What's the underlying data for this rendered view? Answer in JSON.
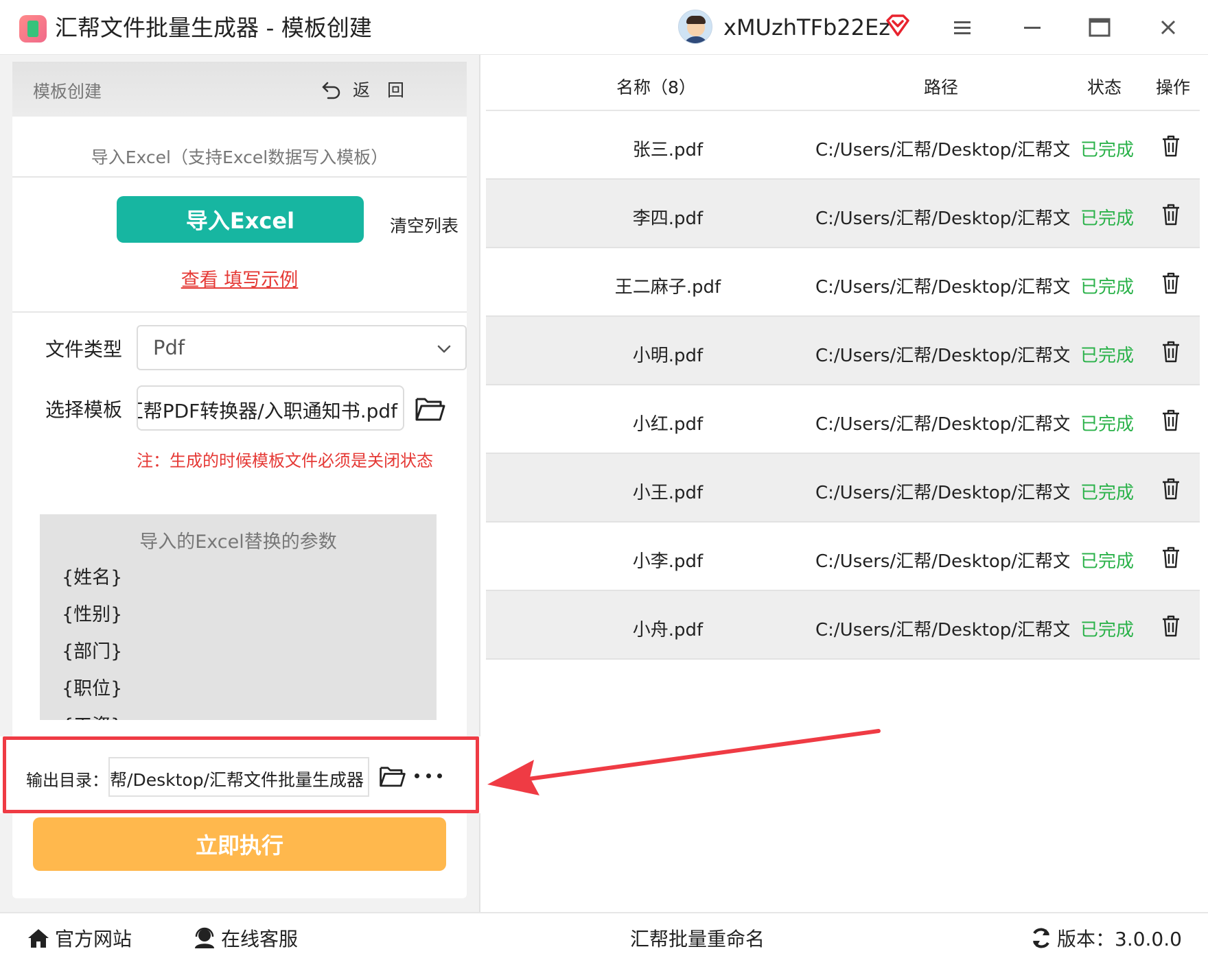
{
  "window": {
    "title": "汇帮文件批量生成器 - 模板创建",
    "username": "xMUzhTFb22Ez"
  },
  "panel": {
    "header_title": "模板创建",
    "back_label": "返　回",
    "import_subtitle": "导入Excel（支持Excel数据写入模板）",
    "import_button": "导入Excel",
    "clear_list": "清空列表",
    "view_example": "查看 填写示例",
    "file_type_label": "文件类型",
    "file_type_value": "Pdf",
    "template_label": "选择模板",
    "template_value": "汇帮PDF转换器/入职通知书.pdf",
    "warning": "注：生成的时候模板文件必须是关闭状态",
    "params_title": "导入的Excel替换的参数",
    "params": [
      "{姓名}",
      "{性别}",
      "{部门}",
      "{职位}",
      "{工资}"
    ],
    "output_label": "输出目录：",
    "output_value": "C:/Users/汇帮/Desktop/汇帮文件批量生成器",
    "run_button": "立即执行"
  },
  "table": {
    "headers": {
      "name": "名称（8）",
      "path": "路径",
      "status": "状态",
      "action": "操作"
    },
    "rows": [
      {
        "name": "张三.pdf",
        "path": "C:/Users/汇帮/Desktop/汇帮文件",
        "status": "已完成"
      },
      {
        "name": "李四.pdf",
        "path": "C:/Users/汇帮/Desktop/汇帮文件",
        "status": "已完成"
      },
      {
        "name": "王二麻子.pdf",
        "path": "C:/Users/汇帮/Desktop/汇帮文件",
        "status": "已完成"
      },
      {
        "name": "小明.pdf",
        "path": "C:/Users/汇帮/Desktop/汇帮文件",
        "status": "已完成"
      },
      {
        "name": "小红.pdf",
        "path": "C:/Users/汇帮/Desktop/汇帮文件",
        "status": "已完成"
      },
      {
        "name": "小王.pdf",
        "path": "C:/Users/汇帮/Desktop/汇帮文件",
        "status": "已完成"
      },
      {
        "name": "小李.pdf",
        "path": "C:/Users/汇帮/Desktop/汇帮文件",
        "status": "已完成"
      },
      {
        "name": "小舟.pdf",
        "path": "C:/Users/汇帮/Desktop/汇帮文件",
        "status": "已完成"
      }
    ]
  },
  "statusbar": {
    "official_site": "官方网站",
    "online_service": "在线客服",
    "center_text": "汇帮批量重命名",
    "version": "版本：3.0.0.0"
  },
  "icons": {
    "app": "app-logo-icon",
    "vip": "diamond-vip-icon",
    "menu": "hamburger-icon",
    "minimize": "minimize-icon",
    "maximize": "maximize-icon",
    "close": "close-icon",
    "back": "back-arrow-icon",
    "dropdown": "chevron-down-icon",
    "folder": "folder-open-icon",
    "more": "more-dots-icon",
    "delete": "trash-icon",
    "home": "home-icon",
    "support": "headset-icon",
    "refresh": "refresh-icon"
  },
  "colors": {
    "accent_teal": "#17b6a1",
    "run_orange": "#ffb84d",
    "status_green": "#2bb24a",
    "warning_red": "#e53935",
    "highlight_red": "#ef3b44"
  }
}
